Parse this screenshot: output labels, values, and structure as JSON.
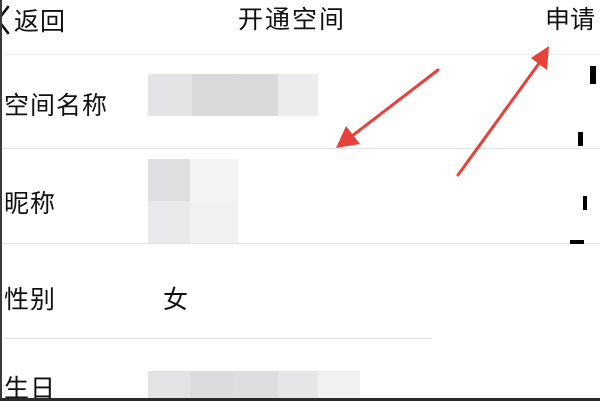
{
  "nav": {
    "back_label": "返回",
    "title": "开通空间",
    "apply_label": "申请"
  },
  "form": {
    "rows": [
      {
        "label": "空间名称",
        "value": ""
      },
      {
        "label": "昵称",
        "value": ""
      },
      {
        "label": "性别",
        "value": "女"
      },
      {
        "label": "生日",
        "value": ""
      }
    ]
  },
  "icons": {
    "back": "chevron-left-icon"
  },
  "colors": {
    "annotation_arrow": "#e8403a",
    "divider": "#e3e3e6",
    "text": "#111111"
  }
}
